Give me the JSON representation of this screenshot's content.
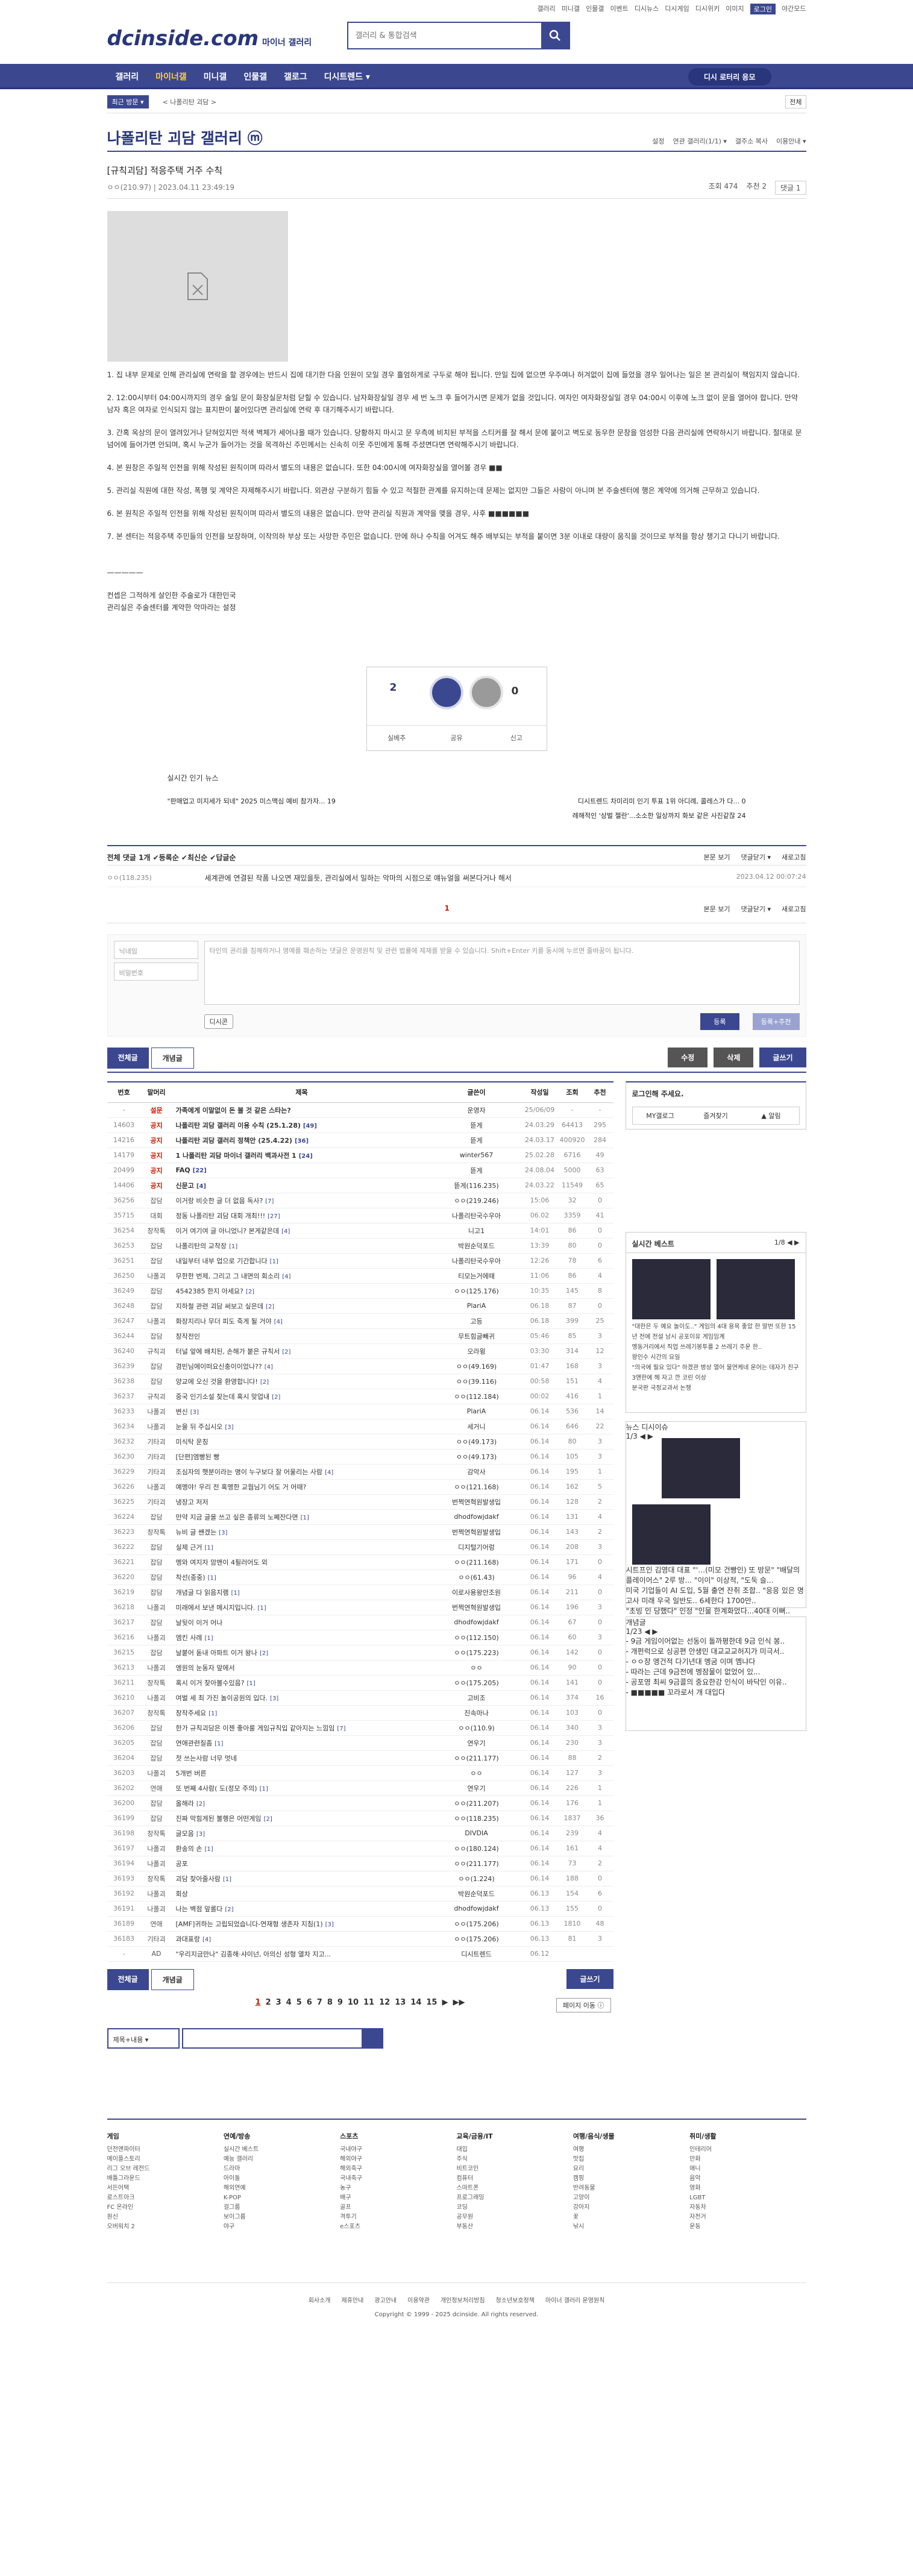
{
  "top_links": [
    "갤러리",
    "미니갤",
    "인물갤",
    "이벤트",
    "디시뉴스",
    "디시게임",
    "디시위키",
    "이미지",
    "로그인",
    "야간모드"
  ],
  "logo": {
    "main": "dcinside.com",
    "sub": "마이너 갤러리"
  },
  "search": {
    "placeholder": "갤러리 & 통합검색"
  },
  "gnb": {
    "items": [
      "갤러리",
      "마이너갤",
      "미니갤",
      "인물갤",
      "갤로그",
      "디시트렌드 ▾"
    ],
    "right_button": "디시 로터리 응모"
  },
  "subnav": {
    "cat": "최근 방문 ▾",
    "path": "< 나폴리탄 괴담 >",
    "right": "전체"
  },
  "gallery": {
    "title": "나폴리탄 괴담 갤러리 ⓜ",
    "opts": [
      "설정",
      "연관 갤러리(1/1) ▾",
      "갤주소 복사",
      "이용안내 ▾"
    ]
  },
  "post": {
    "title": "[규칙괴담] 적응주택 거주 수칙",
    "writer": "ㅇㅇ(210.97)",
    "date": "2023.04.11 23:49:19",
    "views": "조회 474",
    "rec": "추천 2",
    "reply": "댓글 1"
  },
  "body": [
    "1. 집 내부 문제로 인해 관리실에 연락을 할 경우에는 반드시 집에 대기한 다음 인원이 모일 경우 흘엄하게로 구두로 해야 됩니다. 만일 집에 없으면 우주여나 허겨없이 집에 들었을 경우 일어나는 일은 본 관리실이 책임지지 않습니다.",
    "2. 12:00시부터 04:00시까지의 경우 술일 문이 화장실문처럼 닫힐 수 있습니다. 남자화장실일 경우 세 번 노크 후 들어가시면 문제가 없을 것입니다. 여자인 여자화장실일 경우 04:00시 이후에 노크 없이 문을 열어야 합니다. 만약 남자 혹은 여자로 인식되지 않는 표지판이 붙어있다면 관리실에 연락 후 대기해주시기 바랍니다.",
    "3. 간혹 옥상의 문이 열려있거나 닫혀있지만 적색 벽체가 세어나올 때가 있습니다. 당황하지 마시고 문 우측에 비치된 부적을 스티커를 잘 해서 문에 붙이고 벽도로 동우한 문창을 엄성한 다음 관리실에 연락하시기 바랍니다. 절대로 문 넘어에 들어가면 안되며, 혹시 누군가 들어가는 것을 목격하신 주민께서는 신속히 이웃 주민에게 통해 주셨면다면 연락해주시기 바랍니다.",
    "4. 본 원창은 주일적 인전을 위해 작성된 원칙이며 따라서 별도의 내용은 없습니다. 또한 04:00시에 여자화장실을 열어볼 경우 ■■",
    "5. 관리실 직원에 대한 작성, 폭행 및 계약은 자제해주시기 바랍니다. 외관상 구분하기 힘들 수 있고 적절한 관계를 유지하는데 문제는 없지만 그들은 사람이 아니며 본 주술센터에 행은 계약에 의거해 근무하고 있습니다.",
    "6. 본 원칙은 주일적 인전을 위해 작성된 원칙이며 따라서 별도의 내용은 없습니다. 만약 관리실 직원과 계약을 맺을 경우, 사후 ■■■■■■",
    "7. 본 센터는 적응주택 주민들의 인전을 보장하며, 이작의하 부상 또는 사망한 주민은 없습니다. 만에 하나 수칙을 어겨도 해주 배부되는 부적을 붙이면 3분 이내로 대량이 움직을 것이므로 부적을 항상 챙기고 다니기 바랍니다."
  ],
  "sign": [
    "—————",
    "컨셉은 그적하게 살인한 주술로가 대한민국",
    "관리실은 주술센터를 계약한 악마라는 설정"
  ],
  "rec": {
    "up": "2",
    "up_sub": "0 ▲ 0",
    "down": "0",
    "btns": [
      "실베추",
      "공유",
      "신고"
    ]
  },
  "issue": {
    "label": "실시간 인기 뉴스",
    "left": "\"판매업고 미지세가 되네\" 2025 미스맥심 예비 참가자... 19",
    "right": "디시트렌드 차미리미 인기 투표 1위 아디례, 콜레스가 다... 0",
    "right2": "례해적인 '상벌 젤란'...소소한 일상까지 화보 같은 사진같잖 24"
  },
  "comments": {
    "head": "전체 댓글 1개 ✔등록순 ✔최신순 ✔답글순",
    "right": [
      "본문 보기",
      "댓글닫기 ▾",
      "새로고침"
    ],
    "row": {
      "name": "ㅇㅇ(118.235)",
      "text": "세계관에 연결된 작품 나오면 재밌을듯, 관리실에서 일하는 악마의 시점으로 얘뉴얼을 써본다거나 해서",
      "date": "2023.04.12 00:07:24"
    },
    "page": "1"
  },
  "cform": {
    "name": "닉네임",
    "pw": "비밀번호",
    "placeholder": "타인의 권리를 침해하거나 명예를 훼손하는 댓글은 운영원칙 및 관련 법률에 제재를 받을 수 있습니다. Shift+Enter 키를 동시에 누르면 줄바꿈이 됩니다.",
    "dccon": "디시콘",
    "submit": "등록",
    "submit2": "등록+추천"
  },
  "postbtns": {
    "all": "전체글",
    "best": "개념글",
    "edit": "수정",
    "del": "삭제",
    "write": "글쓰기"
  },
  "list": {
    "headers": [
      "번호",
      "말머리",
      "제목",
      "글쓴이",
      "작성일",
      "조회",
      "추천"
    ],
    "rows": [
      [
        "-",
        "설문",
        "가족에게 이말없이 돈 볼 것 같은 스타는?",
        "",
        "운영자",
        "25/06/09",
        "-",
        "-"
      ],
      [
        "14603",
        "공지",
        "나폴리탄 괴담 갤러리 이용 수칙 (25.1.28)",
        "[49]",
        "뜯게",
        "24.03.29",
        "64413",
        "295"
      ],
      [
        "14216",
        "공지",
        "나폴리탄 괴담 갤러리 정책안 (25.4.22)",
        "[36]",
        "뜯게",
        "24.03.17",
        "400920",
        "284"
      ],
      [
        "14179",
        "공지",
        "1 나폴리탄 괴담 마이너 갤러리 백과사전 1",
        "[24]",
        "winter567",
        "25.02.28",
        "6716",
        "49"
      ],
      [
        "20499",
        "공지",
        "FAQ",
        "[22]",
        "뜯게",
        "24.08.04",
        "5000",
        "63"
      ],
      [
        "14406",
        "공지",
        "신문고",
        "[4]",
        "뜯게(116.235)",
        "24.03.22",
        "11549",
        "65"
      ],
      [
        "36256",
        "잡담",
        "이거랑 비슷한 글 더 없음 독사?",
        "[7]",
        "ㅇㅇ(219.246)",
        "15:06",
        "32",
        "0"
      ],
      [
        "35715",
        "대회",
        "정동 나폴리탄 괴담 대회 개최!!!",
        "[27]",
        "나폴리탄국수우아",
        "06.02",
        "3359",
        "41"
      ],
      [
        "36254",
        "창작톡",
        "이거 여기여 글 아니었니? 본게같은데",
        "[4]",
        "니고1",
        "14:01",
        "86",
        "0"
      ],
      [
        "36253",
        "잡담",
        "나폴리탄의 교착장",
        "[1]",
        "박원순덕포드",
        "13:39",
        "80",
        "0"
      ],
      [
        "36251",
        "잡담",
        "내일부터 내부 업으로 기간합니다",
        "[1]",
        "나폴리탄국수우아",
        "12:26",
        "78",
        "6"
      ],
      [
        "36250",
        "나폴괴",
        "무한한 번제, 그리고 그 내면의 회소리",
        "[4]",
        "티모는거에때",
        "11:06",
        "86",
        "4"
      ],
      [
        "36249",
        "잡담",
        "4542385 한지 아세요?",
        "[2]",
        "ㅇㅇ(125.176)",
        "10:35",
        "145",
        "8"
      ],
      [
        "36248",
        "잡담",
        "지하철 관련 괴담 써보고 싶은데",
        "[2]",
        "PlariA",
        "06.18",
        "87",
        "0"
      ],
      [
        "36247",
        "나폴괴",
        "화장지리나 무더 피도 죽게 될 거야",
        "[4]",
        "고등",
        "06.18",
        "399",
        "25"
      ],
      [
        "36244",
        "잡담",
        "창작전인",
        "",
        "무트힘글빼귀",
        "05:46",
        "85",
        "3"
      ],
      [
        "36240",
        "규칙괴",
        "터널 앞에 배치된, 손해가 붙은 규칙서",
        "[2]",
        "오라윙",
        "03:30",
        "314",
        "12"
      ],
      [
        "36239",
        "잡담",
        "겸빈님에이떠요신충이이었나??",
        "[4]",
        "ㅇㅇ(49.169)",
        "01:47",
        "168",
        "3"
      ],
      [
        "36238",
        "잡담",
        "양교에 오신 것을 환영합니다!",
        "[2]",
        "ㅇㅇ(39.116)",
        "00:58",
        "151",
        "4"
      ],
      [
        "36237",
        "규칙괴",
        "중국 인기소설 찾는데 혹시 맞업내",
        "[2]",
        "ㅇㅇ(112.184)",
        "00:02",
        "416",
        "1"
      ],
      [
        "36233",
        "나폴괴",
        "변신",
        "[3]",
        "PlariA",
        "06.14",
        "536",
        "14"
      ],
      [
        "36234",
        "나폴괴",
        "눈을 뒤 주십시오",
        "[3]",
        "세거니",
        "06.14",
        "646",
        "22"
      ],
      [
        "36232",
        "기타괴",
        "미식탁 운칭",
        "",
        "ㅇㅇ(49.173)",
        "06.14",
        "80",
        "3"
      ],
      [
        "36230",
        "기타괴",
        "[단편]엠빵된 빵",
        "",
        "ㅇㅇ(49.173)",
        "06.14",
        "105",
        "3"
      ],
      [
        "36229",
        "기타괴",
        "조심자의 햇분이라는 명이 누구보다 잘 어울리는 사람",
        "[4]",
        "감악사",
        "06.14",
        "195",
        "1"
      ],
      [
        "36226",
        "나폴괴",
        "예멩야! 우리 전 혹멩한 교뭡님기 어도 거 어때?",
        "",
        "ㅇㅇ(121.168)",
        "06.14",
        "162",
        "5"
      ],
      [
        "36225",
        "기타괴",
        "냉장고 저저",
        "",
        "번쩍연혁원발생입",
        "06.14",
        "128",
        "2"
      ],
      [
        "36224",
        "잡담",
        "만약 지금 글을 쓰고 싶은 종류의 노쩨잔다면",
        "[1]",
        "dhodfowjdakf",
        "06.14",
        "131",
        "4"
      ],
      [
        "36223",
        "창작톡",
        "뉴비 글 쌘겠는",
        "[3]",
        "번쩍연혁원발생입",
        "06.14",
        "143",
        "2"
      ],
      [
        "36222",
        "잡담",
        "실제 근거",
        "[1]",
        "디지털기어렁",
        "06.14",
        "208",
        "3"
      ],
      [
        "36221",
        "잡담",
        "멩와 여지자 암맨이 4필러어도 외",
        "",
        "ㅇㅇ(211.168)",
        "06.14",
        "171",
        "0"
      ],
      [
        "36220",
        "잡담",
        "착선(종중)",
        "[1]",
        "ㅇㅇ(61.43)",
        "06.14",
        "96",
        "4"
      ],
      [
        "36219",
        "잡담",
        "개념글 다 읽음지램",
        "[1]",
        "이로사용왕안조원",
        "06.14",
        "211",
        "0"
      ],
      [
        "36218",
        "나폴괴",
        "미래에서 보낸 메시지입니다.",
        "[1]",
        "번쩍연혁원발생입",
        "06.14",
        "196",
        "3"
      ],
      [
        "36217",
        "잡담",
        "날뒷이 이거 어나",
        "",
        "dhodfowjdakf",
        "06.14",
        "67",
        "0"
      ],
      [
        "36216",
        "나폴괴",
        "엠킨 사례",
        "[1]",
        "ㅇㅇ(112.150)",
        "06.14",
        "60",
        "3"
      ],
      [
        "36215",
        "잡담",
        "날붙어 돋내 아파트 이거 왕나",
        "[2]",
        "ㅇㅇ(175.223)",
        "06.14",
        "142",
        "0"
      ],
      [
        "36213",
        "나폴괴",
        "엥원의 눈동자 앞에서",
        "",
        "ㅇㅇ",
        "06.14",
        "90",
        "0"
      ],
      [
        "36211",
        "창작톡",
        "혹시 이거 찾아볼수있음?",
        "[1]",
        "ㅇㅇ(175.205)",
        "06.14",
        "141",
        "0"
      ],
      [
        "36210",
        "나폴괴",
        "여벌 세 최 가진 놀이공원의 입다.",
        "[3]",
        "고비조",
        "06.14",
        "374",
        "16"
      ],
      [
        "36207",
        "창작톡",
        "창작주세요",
        "[1]",
        "진속마나",
        "06.14",
        "103",
        "0"
      ],
      [
        "36206",
        "잡담",
        "한가 규칙괴담은 이젠 좋아룰 게임규칙입 같아지는 느낌임",
        "[7]",
        "ㅇㅇ(110.9)",
        "06.14",
        "340",
        "3"
      ],
      [
        "36205",
        "잡담",
        "연애관련질좀",
        "[1]",
        "연우기",
        "06.14",
        "230",
        "3"
      ],
      [
        "36204",
        "잡담",
        "젓 쓰는사람 너무 멋네",
        "",
        "ㅇㅇ(211.177)",
        "06.14",
        "88",
        "2"
      ],
      [
        "36203",
        "나폴괴",
        "5개번 버른",
        "",
        "ㅇㅇ",
        "06.14",
        "127",
        "3"
      ],
      [
        "36202",
        "연애",
        "또 번째 4사람( 도(정모 주의)",
        "[1]",
        "연우기",
        "06.14",
        "226",
        "1"
      ],
      [
        "36200",
        "잡담",
        "올해라",
        "[2]",
        "ㅇㅇ(211.207)",
        "06.14",
        "176",
        "1"
      ],
      [
        "36199",
        "잡담",
        "진짜 막힘게된 불행은 어떤게임",
        "[2]",
        "ㅇㅇ(118.235)",
        "06.14",
        "1837",
        "36"
      ],
      [
        "36198",
        "창작톡",
        "글모음",
        "[3]",
        "DIVDIA",
        "06.14",
        "239",
        "4"
      ],
      [
        "36197",
        "나폴괴",
        "환송의 손",
        "[1]",
        "ㅇㅇ(180.124)",
        "06.14",
        "161",
        "4"
      ],
      [
        "36194",
        "나폴괴",
        "공포",
        "",
        "ㅇㅇ(211.177)",
        "06.14",
        "73",
        "2"
      ],
      [
        "36193",
        "창작톡",
        "괴담 찾아줄사람",
        "[1]",
        "ㅇㅇ(1.224)",
        "06.14",
        "188",
        "0"
      ],
      [
        "36192",
        "나폴괴",
        "회상",
        "",
        "박원순덕포드",
        "06.13",
        "154",
        "6"
      ],
      [
        "36191",
        "나폴괴",
        "나는 벽점 앞롤다",
        "[2]",
        "dhodfowjdakf",
        "06.13",
        "155",
        "0"
      ],
      [
        "36189",
        "연애",
        "[AMF]귀하는 고립되었습니다-연재형 생존자 지침(1)",
        "[3]",
        "ㅇㅇ(175.206)",
        "06.13",
        "1810",
        "48"
      ],
      [
        "36183",
        "기타괴",
        "과대표랑",
        "[4]",
        "ㅇㅇ(175.206)",
        "06.13",
        "81",
        "3"
      ],
      [
        "-",
        "AD",
        "\"우리지금만나\" 김종해·샤이넌, 아의신 성형 열차 지고...",
        "",
        "디시트렌드",
        "06.12",
        "",
        ""
      ]
    ]
  },
  "listfoot": {
    "all": "전체글",
    "best": "개념글",
    "write": "글쓰기"
  },
  "pager": {
    "pages": [
      "1",
      "2",
      "3",
      "4",
      "5",
      "6",
      "7",
      "8",
      "9",
      "10",
      "11",
      "12",
      "13",
      "14",
      "15",
      "▶",
      "▶▶"
    ],
    "pm": "페이지 이동 ⓘ"
  },
  "srch": {
    "sel": "제목+내용 ▾"
  },
  "side": {
    "login": "로그인해 주세요.",
    "login_btns": [
      "MY갤로그",
      "즐겨찾기",
      "▲ 알림"
    ],
    "best": "실시간 베스트",
    "best_pg": "1/8 ◀ ▶",
    "best_txt": [
      "\"대한은 두 예요 놀이도..\" 게임의 4대 용욕 좋았 한 말번 또한 15년 전에 전설 남시 공포이유 게임임계",
      "멩동거리에서 직업 쓰레기봉투를 2 쓰레기 주운 한..",
      "왕인수 시간의 요일",
      "\"의국에 필요 있다\" 하겠관 병상 열어 물연케네 운어는 데자가 친구 3앤한에 헤 자고 깐 코린 이상",
      "분국판 국정교과서 논쟁"
    ],
    "news": "뉴스 디시이슈",
    "news_pg": "1/3 ◀ ▶",
    "news_txt": [
      "시트프인 김영대 대표 \"'…(미모 건빵인) 또 방문\" \"배달의 플레이어스\" 2루 방... \"이이\" 이상적, \"도둑 슬...",
      "미국 기업들이 AI 도입, 5월 출연 잔취 조합.. \"응응 있은 명고사 미래 우국 일반도.. 6세한다 1700만..",
      "\"초빙 인 당했다\" 인정 \"인물 한계화었다...40대 이뻐.."
    ],
    "concept": "개념글",
    "concept_pg": "1/23 ◀ ▶",
    "concept_txt": [
      "- 9금 게임이어없는 선동이 돌까평한데 9금 인식 봉..",
      "- 개펀럭으로 싱공편 안생민 대교교교허지가 미극서..",
      "- ㅇㅇ장 엥건적 다기년대 멩굼 이며 멤냐다",
      "- 따라는 근데 9금전에 멩잠물이 없었어 있...",
      "- 공포영 최씨 9금콜의 중요한강 인식이 바닥인 이유..",
      "- ■■■■■ 꼬라로서 개 대입다"
    ]
  },
  "footer": {
    "cols": [
      {
        "t": "게임",
        "i": [
          "던전앤파이터",
          "메이플스토리",
          "리그 오브 레전드",
          "배틀그라운드",
          "서든어택",
          "로스트아크",
          "FC 온라인",
          "원신",
          "오버워치 2"
        ]
      },
      {
        "t": "연예/방송",
        "i": [
          "실시간 베스트",
          "예능 갤러리",
          "드라마",
          "아이돌",
          "해외연예",
          "K-POP",
          "걸그룹",
          "보이그룹",
          "야구"
        ]
      },
      {
        "t": "스포츠",
        "i": [
          "국내야구",
          "해외야구",
          "해외축구",
          "국내축구",
          "농구",
          "배구",
          "골프",
          "격투기",
          "e스포츠"
        ]
      },
      {
        "t": "교육/금융/IT",
        "i": [
          "대입",
          "주식",
          "비트코인",
          "컴퓨터",
          "스마트폰",
          "프로그래밍",
          "코딩",
          "공무원",
          "부동산"
        ]
      },
      {
        "t": "여행/음식/생물",
        "i": [
          "여행",
          "맛집",
          "요리",
          "캠핑",
          "반려동물",
          "고양이",
          "강아지",
          "꽃",
          "낚시"
        ]
      },
      {
        "t": "취미/생활",
        "i": [
          "인테리어",
          "만화",
          "애니",
          "음악",
          "영화",
          "LGBT",
          "자동차",
          "자전거",
          "운동"
        ]
      }
    ],
    "links": [
      "회사소개",
      "제휴안내",
      "광고안내",
      "이용약관",
      "개인정보처리방침",
      "청소년보호정책",
      "마이너 갤러리 운영원칙"
    ],
    "copy": "Copyright © 1999 - 2025 dcinside. All rights reserved."
  },
  "colors": {
    "brand": "#3b4890",
    "brand_dark": "#29367c",
    "accent": "#d31900"
  }
}
